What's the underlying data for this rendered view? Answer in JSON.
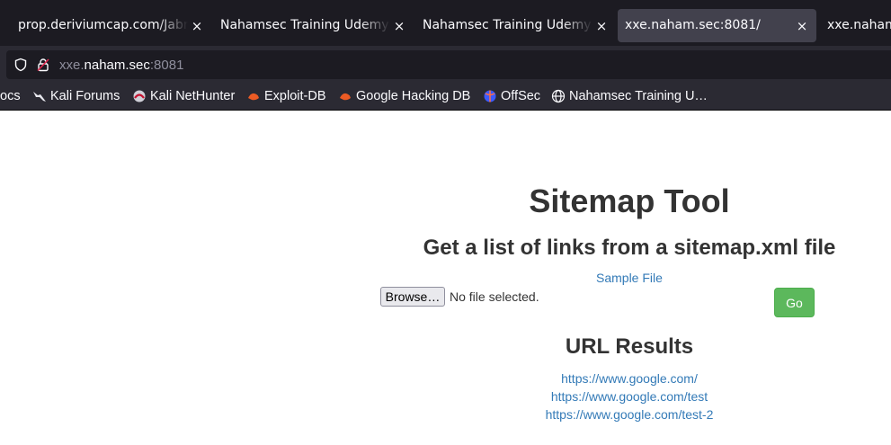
{
  "browser": {
    "tabs": [
      {
        "title": "prop.deriviumcap.com/Jabra",
        "active": false
      },
      {
        "title": "Nahamsec Training Udemy C",
        "active": false
      },
      {
        "title": "Nahamsec Training Udemy C",
        "active": false
      },
      {
        "title": "xxe.naham.sec:8081/",
        "active": true
      },
      {
        "title": "xxe.naham",
        "active": false
      }
    ],
    "close_glyph": "×",
    "url": {
      "prefix": "xxe.",
      "host": "naham.sec",
      "port": ":8081"
    },
    "bookmarks": [
      {
        "label": "ocs",
        "icon": "docs-icon"
      },
      {
        "label": "Kali Forums",
        "icon": "kali-dragon-icon"
      },
      {
        "label": "Kali NetHunter",
        "icon": "nethunter-icon"
      },
      {
        "label": "Exploit-DB",
        "icon": "exploit-db-icon"
      },
      {
        "label": "Google Hacking DB",
        "icon": "ghdb-icon"
      },
      {
        "label": "OffSec",
        "icon": "offsec-icon"
      },
      {
        "label": "Nahamsec Training U…",
        "icon": "globe-icon"
      }
    ]
  },
  "page": {
    "title": "Sitemap Tool",
    "subtitle": "Get a list of links from a sitemap.xml file",
    "sample_link": "Sample File",
    "browse_label": "Browse…",
    "file_status": "No file selected.",
    "go_label": "Go",
    "results_heading": "URL Results",
    "results": [
      "https://www.google.com/",
      "https://www.google.com/test",
      "https://www.google.com/test-2"
    ]
  },
  "colors": {
    "link": "#337ab7",
    "go_button": "#5cb85c",
    "tabbar": "#1c1b22",
    "toolbar": "#2b2a33"
  }
}
